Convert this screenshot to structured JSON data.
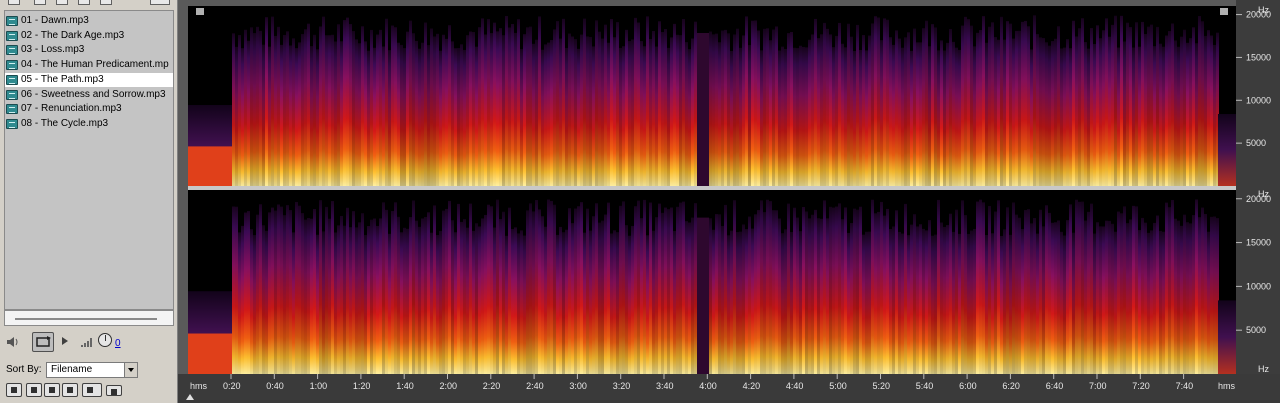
{
  "file_list": [
    {
      "label": "01 - Dawn.mp3",
      "selected": false
    },
    {
      "label": "02 - The Dark Age.mp3",
      "selected": false
    },
    {
      "label": "03 - Loss.mp3",
      "selected": false
    },
    {
      "label": "04 - The Human Predicament.mp",
      "selected": false
    },
    {
      "label": "05 - The Path.mp3",
      "selected": true
    },
    {
      "label": "06 - Sweetness and Sorrow.mp3",
      "selected": false
    },
    {
      "label": "07 - Renunciation.mp3",
      "selected": false
    },
    {
      "label": "08 - The Cycle.mp3",
      "selected": false
    }
  ],
  "transport": {
    "volume_value": "0"
  },
  "sort": {
    "label": "Sort By:",
    "value": "Filename"
  },
  "icons": {
    "file": "audio-file-icon",
    "speaker": "speaker-icon",
    "loop": "loop-icon",
    "play": "play-icon",
    "volume": "volume-knob-icon"
  },
  "spectrogram": {
    "freq_unit": "Hz",
    "freq_ticks": [
      "20000",
      "15000",
      "10000",
      "5000"
    ],
    "time_unit": "hms",
    "time_ticks": [
      "0:20",
      "0:40",
      "1:00",
      "1:20",
      "1:40",
      "2:00",
      "2:20",
      "2:40",
      "3:00",
      "3:20",
      "3:40",
      "4:00",
      "4:20",
      "4:40",
      "5:00",
      "5:20",
      "5:40",
      "6:00",
      "6:20",
      "6:40",
      "7:00",
      "7:20",
      "7:40"
    ],
    "colors": {
      "background": "#000000",
      "low": "#2a0845",
      "mid": "#cc1010",
      "high": "#ffd040",
      "peak": "#fff2b0"
    }
  }
}
